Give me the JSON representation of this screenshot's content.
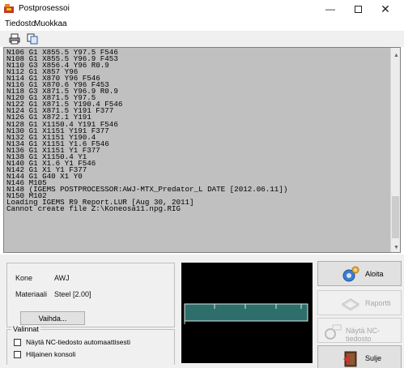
{
  "window": {
    "title": "Postprosessoi",
    "minimize_glyph": "—",
    "close_glyph": "✕"
  },
  "menu": {
    "file": "Tiedosto",
    "edit": "Muokkaa"
  },
  "toolbar": {
    "icons": [
      "printer-icon",
      "copy-icon"
    ]
  },
  "console": {
    "lines": [
      "N106 G1 X855.5 Y97.5 F546",
      "N108 G1 X855.5 Y96.9 F453",
      "N110 G3 X856.4 Y96 R0.9",
      "N112 G1 X857 Y96",
      "N114 G1 X870 Y96 F546",
      "N116 G1 X870.6 Y96 F453",
      "N118 G3 X871.5 Y96.9 R0.9",
      "N120 G1 X871.5 Y97.5",
      "N122 G1 X871.5 Y190.4 F546",
      "N124 G1 X871.5 Y191 F377",
      "N126 G1 X872.1 Y191",
      "N128 G1 X1150.4 Y191 F546",
      "N130 G1 X1151 Y191 F377",
      "N132 G1 X1151 Y190.4",
      "N134 G1 X1151 Y1.6 F546",
      "N136 G1 X1151 Y1 F377",
      "N138 G1 X1150.4 Y1",
      "N140 G1 X1.6 Y1 F546",
      "N142 G1 X1 Y1 F377",
      "N144 G1 G40 X1 Y0",
      "N146 M105",
      "N148 (IGEMS POSTPROCESSOR:AWJ-MTX_Predator_L DATE [2012.06.11])",
      "N150 M102",
      "Loading IGEMS R9 Report.LUR [Aug 30, 2011]",
      "Cannot create file Z:\\Koneosa11.npg.RIG"
    ]
  },
  "machine": {
    "kone_label": "Kone",
    "kone_value": "AWJ",
    "materiaali_label": "Materiaali",
    "materiaali_value": "Steel [2.00]",
    "change_button": "Vaihda..."
  },
  "options": {
    "legend": "Valinnat",
    "show_nc": "Näytä NC-tiedosto automaattisesti",
    "quiet_console": "Hiljainen konsoli"
  },
  "actions": {
    "start": "Aloita",
    "report": "Raportti",
    "show_nc": "Näytä NC-tiedosto",
    "close": "Sulje"
  },
  "colors": {
    "console_bg": "#c0c0c0",
    "preview_bg": "#000000",
    "part_fill": "#2f6f6b",
    "part_stroke": "#d9e6e4"
  }
}
